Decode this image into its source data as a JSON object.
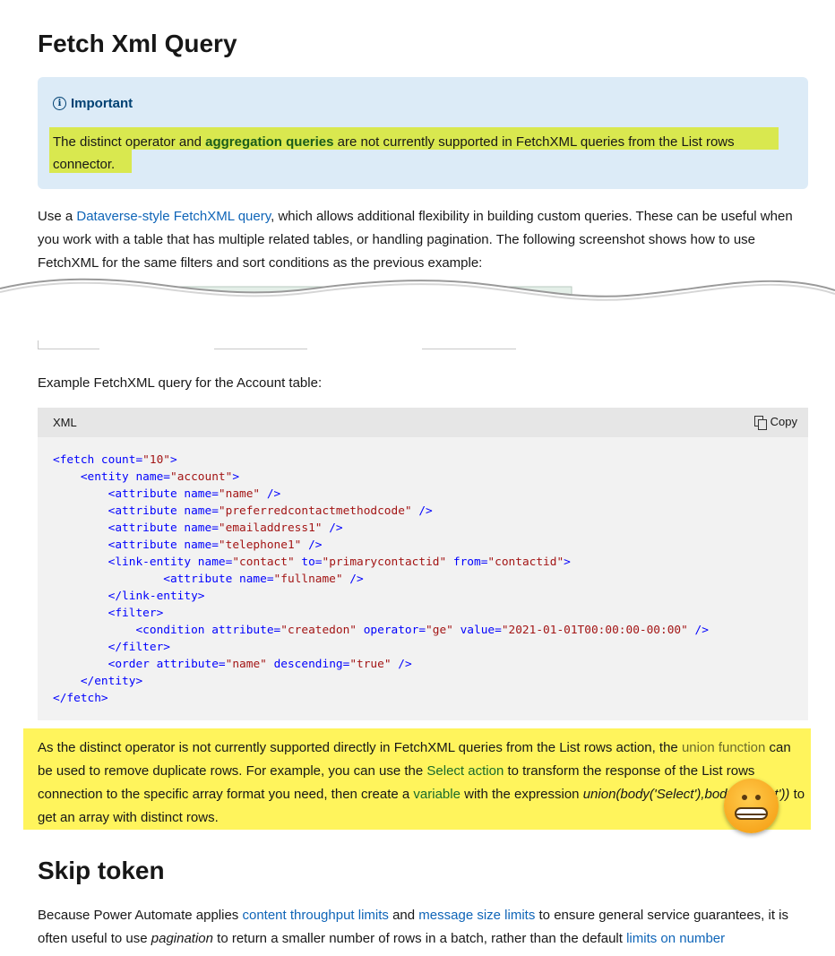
{
  "heading": "Fetch Xml Query",
  "important": {
    "title": "Important",
    "text_before": "The distinct operator and ",
    "bold_link": "aggregation queries",
    "text_after": " are not currently supported in FetchXML queries from the List rows connector."
  },
  "intro": {
    "before": "Use a ",
    "link": "Dataverse-style FetchXML query",
    "after": ", which allows additional flexibility in building custom queries. These can be useful when you work with a table that has multiple related tables, or handling pagination. The following screenshot shows how to use FetchXML for the same filters and sort conditions as the previous example:"
  },
  "example_caption": "Example FetchXML query for the Account table:",
  "code": {
    "language": "XML",
    "copy_label": "Copy",
    "lines": [
      "<fetch count=\"10\">",
      "    <entity name=\"account\">",
      "        <attribute name=\"name\" />",
      "        <attribute name=\"preferredcontactmethodcode\" />",
      "        <attribute name=\"emailaddress1\" />",
      "        <attribute name=\"telephone1\" />",
      "        <link-entity name=\"contact\" to=\"primarycontactid\" from=\"contactid\">",
      "                <attribute name=\"fullname\" />",
      "        </link-entity>",
      "        <filter>",
      "            <condition attribute=\"createdon\" operator=\"ge\" value=\"2021-01-01T00:00:00-00:00\" />",
      "        </filter>",
      "        <order attribute=\"name\" descending=\"true\" />",
      "    </entity>",
      "</fetch>"
    ]
  },
  "note": {
    "t1": "As the distinct operator is not currently supported directly in FetchXML queries from the List rows action, the ",
    "link1": "union function",
    "t2": " can be used to remove duplicate rows. For example, you can use the ",
    "link2": "Select action",
    "t3": " to transform the response of the List rows connection to the specific array format you need, then create a ",
    "link3": "variable",
    "t4": " with the expression ",
    "expr": "union(body('Select'),body('Select'))",
    "t5": " to get an array with distinct rows."
  },
  "skip_heading": "Skip token",
  "skip": {
    "t1": "Because Power Automate applies ",
    "link1": "content throughput limits",
    "t2": " and ",
    "link2": "message size limits",
    "t3": " to ensure general service guarantees, it is often useful to use ",
    "em": "pagination",
    "t4": " to return a smaller number of rows in a batch, rather than the default ",
    "link3": "limits on number"
  },
  "colors": {
    "link": "#0f65b8",
    "alert_bg": "#dcebf7",
    "highlight_lime": "#d9e84f",
    "highlight_yellow": "#fff45c",
    "code_tag": "#0101fd",
    "code_value": "#a31515"
  },
  "icons": [
    "info-icon",
    "copy-icon",
    "grimace-emoji-icon"
  ]
}
